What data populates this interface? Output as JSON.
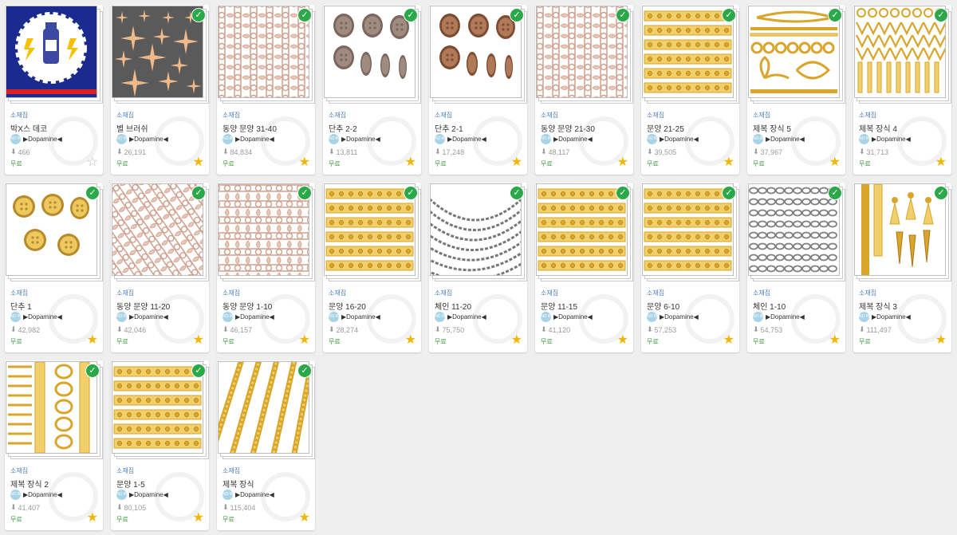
{
  "colors": {
    "check": "#2aa84a",
    "star_on": "#f2b500",
    "star_off": "#b8b8b8",
    "category": "#4a7fbf",
    "price": "#3a9a3a"
  },
  "items": [
    {
      "category": "소재집",
      "title": "박X스 데코",
      "author": "▶Dopamine◀",
      "downloads": "466",
      "price": "무료",
      "starred": false,
      "checked": false,
      "thumb": "badge"
    },
    {
      "category": "소재집",
      "title": "별 브러쉬",
      "author": "▶Dopamine◀",
      "downloads": "26,191",
      "price": "무료",
      "starred": true,
      "checked": true,
      "thumb": "stars"
    },
    {
      "category": "소재집",
      "title": "동양 문양 31-40",
      "author": "▶Dopamine◀",
      "downloads": "84,834",
      "price": "무료",
      "starred": true,
      "checked": true,
      "thumb": "pattern-copper-v"
    },
    {
      "category": "소재집",
      "title": "단추 2-2",
      "author": "▶Dopamine◀",
      "downloads": "13,811",
      "price": "무료",
      "starred": true,
      "checked": true,
      "thumb": "buttons-gray"
    },
    {
      "category": "소재집",
      "title": "단추 2-1",
      "author": "▶Dopamine◀",
      "downloads": "17,248",
      "price": "무료",
      "starred": true,
      "checked": true,
      "thumb": "buttons-brown"
    },
    {
      "category": "소재집",
      "title": "동양 문양 21-30",
      "author": "▶Dopamine◀",
      "downloads": "48,117",
      "price": "무료",
      "starred": true,
      "checked": true,
      "thumb": "pattern-copper-v"
    },
    {
      "category": "소재집",
      "title": "문양 21-25",
      "author": "▶Dopamine◀",
      "downloads": "39,505",
      "price": "무료",
      "starred": true,
      "checked": true,
      "thumb": "gold-bands"
    },
    {
      "category": "소재집",
      "title": "제복 장식 5",
      "author": "▶Dopamine◀",
      "downloads": "37,967",
      "price": "무료",
      "starred": true,
      "checked": true,
      "thumb": "gold-cords"
    },
    {
      "category": "소재집",
      "title": "제복 장식 4",
      "author": "▶Dopamine◀",
      "downloads": "31,713",
      "price": "무료",
      "starred": true,
      "checked": true,
      "thumb": "gold-lattice"
    },
    {
      "category": "소재집",
      "title": "단추 1",
      "author": "▶Dopamine◀",
      "downloads": "42,982",
      "price": "무료",
      "starred": true,
      "checked": true,
      "thumb": "buttons-gold"
    },
    {
      "category": "소재집",
      "title": "동양 문양 11-20",
      "author": "▶Dopamine◀",
      "downloads": "42,046",
      "price": "무료",
      "starred": true,
      "checked": true,
      "thumb": "pattern-copper-d"
    },
    {
      "category": "소재집",
      "title": "동양 문양 1-10",
      "author": "▶Dopamine◀",
      "downloads": "46,157",
      "price": "무료",
      "starred": true,
      "checked": true,
      "thumb": "pattern-copper-h"
    },
    {
      "category": "소재집",
      "title": "문양 16-20",
      "author": "▶Dopamine◀",
      "downloads": "28,274",
      "price": "무료",
      "starred": true,
      "checked": true,
      "thumb": "gold-bands"
    },
    {
      "category": "소재집",
      "title": "체인 11-20",
      "author": "▶Dopamine◀",
      "downloads": "75,750",
      "price": "무료",
      "starred": true,
      "checked": true,
      "thumb": "chain-arcs"
    },
    {
      "category": "소재집",
      "title": "문양 11-15",
      "author": "▶Dopamine◀",
      "downloads": "41,120",
      "price": "무료",
      "starred": true,
      "checked": true,
      "thumb": "gold-bands"
    },
    {
      "category": "소재집",
      "title": "문양 6-10",
      "author": "▶Dopamine◀",
      "downloads": "57,253",
      "price": "무료",
      "starred": true,
      "checked": true,
      "thumb": "gold-bands"
    },
    {
      "category": "소재집",
      "title": "체인 1-10",
      "author": "▶Dopamine◀",
      "downloads": "54,753",
      "price": "무료",
      "starred": true,
      "checked": true,
      "thumb": "chain-h"
    },
    {
      "category": "소재집",
      "title": "제복 장식 3",
      "author": "▶Dopamine◀",
      "downloads": "111,497",
      "price": "무료",
      "starred": true,
      "checked": true,
      "thumb": "gold-tassels"
    },
    {
      "category": "소재집",
      "title": "제복 장식 2",
      "author": "▶Dopamine◀",
      "downloads": "41,407",
      "price": "무료",
      "starred": true,
      "checked": true,
      "thumb": "gold-vert"
    },
    {
      "category": "소재집",
      "title": "문양 1-5",
      "author": "▶Dopamine◀",
      "downloads": "80,105",
      "price": "무료",
      "starred": true,
      "checked": true,
      "thumb": "gold-bands"
    },
    {
      "category": "소재집",
      "title": "제복 장식",
      "author": "▶Dopamine◀",
      "downloads": "115,404",
      "price": "무료",
      "starred": true,
      "checked": true,
      "thumb": "gold-ropes"
    }
  ]
}
